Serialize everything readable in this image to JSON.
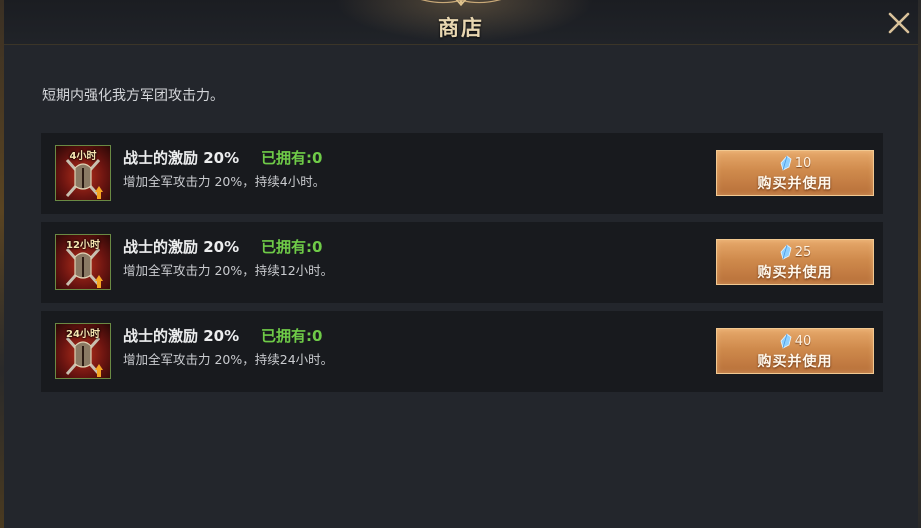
{
  "header": {
    "title": "商店"
  },
  "description": "短期内强化我方军团攻击力。",
  "items": [
    {
      "icon_label": "4小时",
      "name": "战士的激励 20%",
      "owned": "已拥有:0",
      "desc": "增加全军攻击力 20%，持续4小时。",
      "price": "10",
      "button_label": "购买并使用"
    },
    {
      "icon_label": "12小时",
      "name": "战士的激励 20%",
      "owned": "已拥有:0",
      "desc": "增加全军攻击力 20%，持续12小时。",
      "price": "25",
      "button_label": "购买并使用"
    },
    {
      "icon_label": "24小时",
      "name": "战士的激励 20%",
      "owned": "已拥有:0",
      "desc": "增加全军攻击力 20%，持续24小时。",
      "price": "40",
      "button_label": "购买并使用"
    }
  ],
  "icons": {
    "close": "close-icon",
    "currency": "crystal-icon",
    "item": "warrior-helmet-icon"
  },
  "colors": {
    "owned_text": "#6fcb48",
    "button_fill": "#cf8a4c",
    "title_text": "#e8d6b0"
  }
}
